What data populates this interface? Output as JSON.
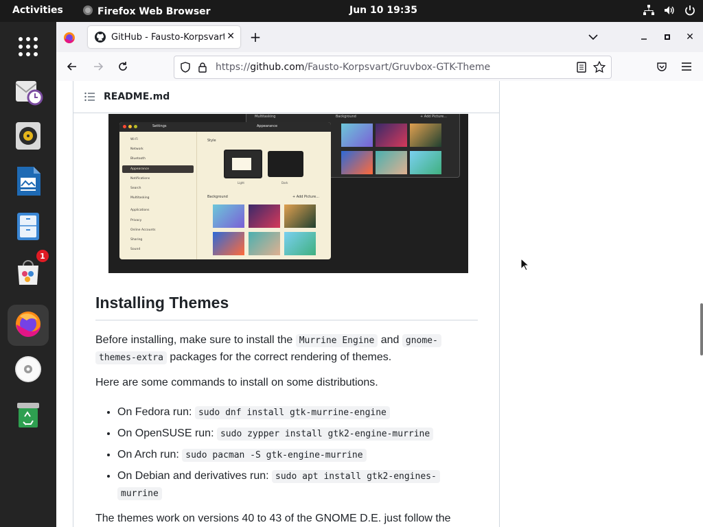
{
  "topbar": {
    "activities": "Activities",
    "app_name": "Firefox Web Browser",
    "clock": "Jun 10  19:35"
  },
  "dock": {
    "items": [
      {
        "icon": "app-grid-icon"
      },
      {
        "icon": "mail-icon"
      },
      {
        "icon": "speaker-icon"
      },
      {
        "icon": "document-icon"
      },
      {
        "icon": "files-icon"
      },
      {
        "icon": "software-bag-icon",
        "badge": "1"
      },
      {
        "icon": "firefox-icon",
        "active": true
      },
      {
        "icon": "disc-icon"
      },
      {
        "icon": "trash-icon"
      }
    ]
  },
  "browser": {
    "tab_title": "GitHub - Fausto-Korpsvart/Gruvbox-GTK-Theme",
    "url_prefix": "https://",
    "url_domain": "github.com",
    "url_path": "/Fausto-Korpsvart/Gruvbox-GTK-Theme"
  },
  "readme": {
    "filename": "README.md",
    "heading": "Installing Themes",
    "p1_a": "Before installing, make sure to install the ",
    "p1_code1": "Murrine Engine",
    "p1_b": " and ",
    "p1_code2a": "gnome-",
    "p1_code2b": "themes-extra",
    "p1_c": " packages for the correct rendering of themes.",
    "p2": "Here are some commands to install on some distributions.",
    "list": [
      {
        "label": "On Fedora run: ",
        "code": "sudo dnf install gtk-murrine-engine"
      },
      {
        "label": "On OpenSUSE run: ",
        "code": "sudo zypper install gtk2-engine-murrine"
      },
      {
        "label": "On Arch run: ",
        "code": "sudo pacman -S gtk-engine-murrine"
      },
      {
        "label": "On Debian and derivatives run: ",
        "code": "sudo apt install gtk2-engines-",
        "code2": "murrine"
      }
    ],
    "p3": "The themes work on versions 40 to 43 of the GNOME D.E. just follow the"
  },
  "screenshot": {
    "window_title": "Settings",
    "panel_title": "Appearance",
    "style_label": "Style",
    "light_label": "Light",
    "dark_label": "Dark",
    "background_label": "Background",
    "add_picture": "+ Add Picture...",
    "bg_label_right": "Background",
    "multitasking": "Multitasking",
    "sidebar": [
      "Wi-Fi",
      "Network",
      "Bluetooth",
      "Appearance",
      "Notifications",
      "Search",
      "Multitasking",
      "Applications",
      "Privacy",
      "Online Accounts",
      "Sharing",
      "Sound"
    ]
  },
  "colors": {
    "topbar": "#1a1a1a",
    "dock": "#242424",
    "chrome": "#f0f0f4",
    "text": "#1f2328",
    "code_bg": "#f1f2f4",
    "screenshot_bg": "#1f1f1f",
    "gtk_light": "#f5efd8"
  }
}
